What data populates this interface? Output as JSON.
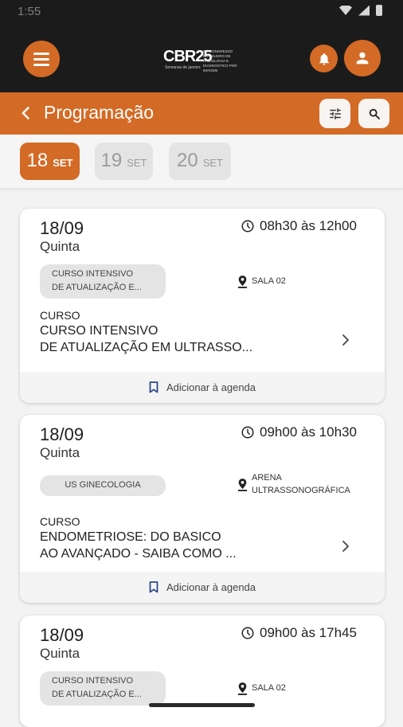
{
  "status": {
    "time": "1:55"
  },
  "header": {
    "logo_big": "CBR25",
    "logo_small": "53º CONGRESSO BRASILEIRO DE RADIOLOGIA E DIAGNÓSTICO POR IMAGEM",
    "logo_tag": "Semanas de janeiro"
  },
  "titlebar": {
    "title": "Programação"
  },
  "dates": [
    {
      "day": "18",
      "month": "SET"
    },
    {
      "day": "19",
      "month": "SET"
    },
    {
      "day": "20",
      "month": "SET"
    }
  ],
  "events": [
    {
      "date": "18/09",
      "weekday": "Quinta",
      "time": "08h30 às 12h00",
      "tag_line1": "CURSO INTENSIVO",
      "tag_line2": "DE ATUALIZAÇÃO E...",
      "location_line1": "SALA 02",
      "location_line2": "",
      "type": "CURSO",
      "title_line1": "CURSO INTENSIVO",
      "title_line2": "DE ATUALIZAÇÃO EM ULTRASSO...",
      "footer": "Adicionar à agenda"
    },
    {
      "date": "18/09",
      "weekday": "Quinta",
      "time": "09h00 às 10h30",
      "tag_line1": "US GINECOLOGIA",
      "tag_line2": "",
      "location_line1": "ARENA",
      "location_line2": "ULTRASSONOGRÁFICA",
      "type": "CURSO",
      "title_line1": "ENDOMETRIOSE: DO BASICO",
      "title_line2": "AO AVANÇADO - SAIBA COMO ...",
      "footer": "Adicionar à agenda"
    },
    {
      "date": "18/09",
      "weekday": "Quinta",
      "time": "09h00 às 17h45",
      "tag_line1": "CURSO INTENSIVO",
      "tag_line2": "DE ATUALIZAÇÃO E...",
      "location_line1": "SALA 02",
      "location_line2": ""
    }
  ],
  "colors": {
    "accent": "#d36a25",
    "dark": "#1b1b1b"
  }
}
